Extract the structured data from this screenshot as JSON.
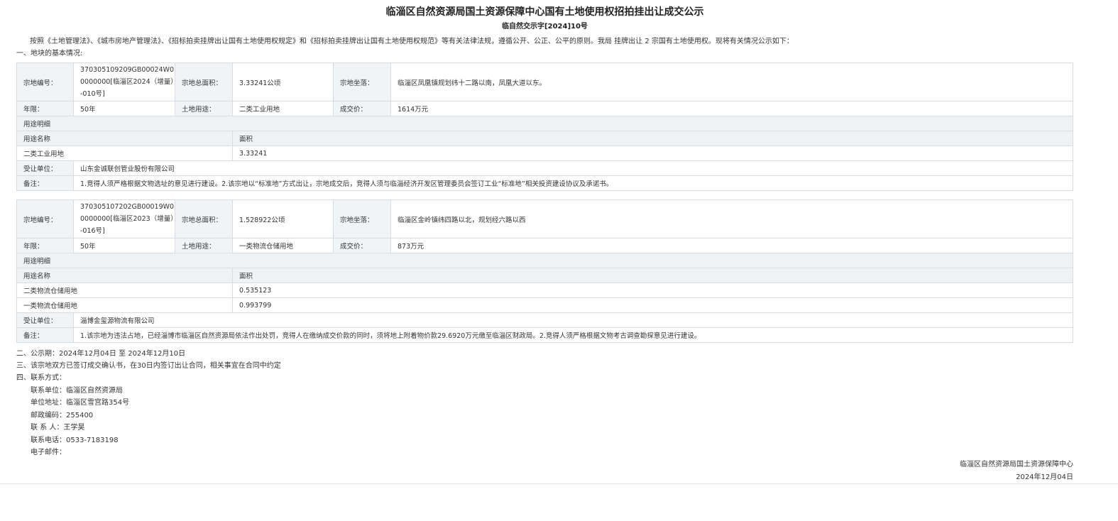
{
  "header": {
    "title": "临淄区自然资源局国土资源保障中心国有土地使用权招拍挂出让成交公示",
    "doc_number": "临自然交示字[2024]10号"
  },
  "intro": "按照《土地管理法》、《城市房地产管理法》、《招标拍卖挂牌出让国有土地使用权规定》和《招标拍卖挂牌出让国有土地使用权规范》等有关法律法规，遵循公开、公正、公平的原则。我局 挂牌出让 2 宗国有土地使用权。现将有关情况公示如下：",
  "section1_heading": "一、地块的基本情况:",
  "labels": {
    "parcel_no": "宗地编号：",
    "total_area": "宗地总面积：",
    "location": "宗地坐落：",
    "term": "年限：",
    "land_use": "土地用途：",
    "deal_price": "成交价：",
    "use_detail": "用途明细",
    "use_name": "用途名称",
    "area": "面积",
    "transferee": "受让单位：",
    "remark": "备注："
  },
  "parcels": [
    {
      "parcel_no": "370305109209GB00024W00000000[临淄区2024（增量）-010号]",
      "total_area": "3.33241公顷",
      "location": "临淄区凤凰镇规划纬十二路以南，凤凰大道以东。",
      "term": "50年",
      "land_use": "二类工业用地",
      "deal_price": "1614万元",
      "uses": [
        {
          "name": "二类工业用地",
          "area": "3.33241"
        }
      ],
      "transferee": "山东金诚联创管业股份有限公司",
      "remark": "1.竞得人须严格根据文物选址的意见进行建设。2.该宗地以“标准地”方式出让，宗地成交后，竞得人须与临淄经济开发区管理委员会签订工业“标准地”相关投资建设协议及承诺书。"
    },
    {
      "parcel_no": "370305107202GB00019W00000000[临淄区2023（增量）-016号]",
      "total_area": "1.528922公顷",
      "location": "临淄区金岭镇纬四路以北，规划经六路以西",
      "term": "50年",
      "land_use": "一类物流仓储用地",
      "deal_price": "873万元",
      "uses": [
        {
          "name": "二类物流仓储用地",
          "area": "0.535123"
        },
        {
          "name": "一类物流仓储用地",
          "area": "0.993799"
        }
      ],
      "transferee": "淄博金玺源物流有限公司",
      "remark": "1.该宗地为违法占地，已经淄博市临淄区自然资源局依法作出处罚，竞得人在缴纳成交价款的同时，须将地上附着物价款29.6920万元缴至临淄区财政局。2.竞得人须严格根据文物考古调查勘探意见进行建设。"
    }
  ],
  "section2": "二、公示期：2024年12月04日 至 2024年12月10日",
  "section3": "三、该宗地双方已签订成交确认书，在30日内签订出让合同，相关事宜在合同中约定",
  "section4_heading": "四、联系方式：",
  "contact": {
    "unit": "联系单位：临淄区自然资源局",
    "address": "单位地址：临淄区雪宫路354号",
    "postcode": "邮政编码：255400",
    "person": "联 系 人：王学昊",
    "phone": "联系电话：0533-7183198",
    "email": "电子邮件："
  },
  "footer": {
    "org": "临淄区自然资源局国土资源保障中心",
    "date": "2024年12月04日"
  }
}
